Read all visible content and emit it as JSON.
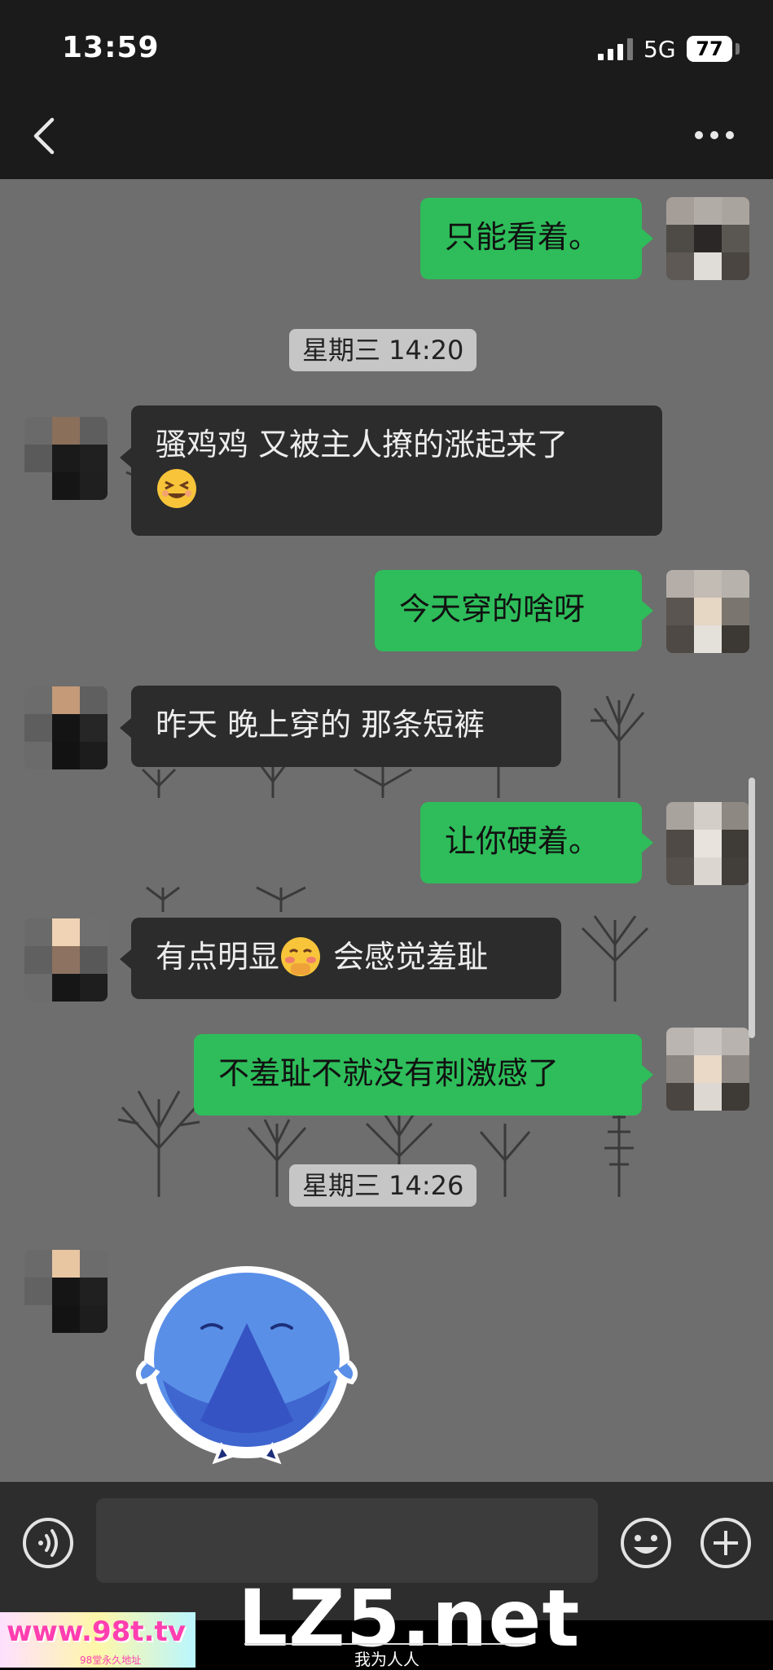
{
  "status_bar": {
    "time": "13:59",
    "network": "5G",
    "battery": "77"
  },
  "nav": {
    "back_icon": "chevron-left-icon",
    "more_icon": "more-dots-icon"
  },
  "messages": [
    {
      "side": "me",
      "text": "只能看着。"
    },
    {
      "type": "timestamp",
      "text": "星期三 14:20"
    },
    {
      "side": "them",
      "text": "骚鸡鸡 又被主人撩的涨起来了",
      "emoji": "grinning-squint-face"
    },
    {
      "side": "me",
      "text": "今天穿的啥呀"
    },
    {
      "side": "them",
      "text": "昨天 晚上穿的 那条短裤"
    },
    {
      "side": "me",
      "text": "让你硬着。"
    },
    {
      "side": "them",
      "text_before": "有点明显",
      "emoji": "shy-face",
      "text_after": "会感觉羞耻"
    },
    {
      "side": "me",
      "text": "不羞耻不就没有刺激感了"
    },
    {
      "type": "timestamp",
      "text": "星期三 14:26"
    },
    {
      "side": "them",
      "type": "sticker",
      "sticker": "blue-round-character-sticker"
    }
  ],
  "input_bar": {
    "voice_icon": "voice-icon",
    "emoji_icon": "smiley-icon",
    "plus_icon": "plus-icon"
  },
  "watermarks": {
    "main": "LZ5.net",
    "sub": "我为人人",
    "left": "www.98t.tv",
    "left_sub": "98堂永久地址"
  },
  "colors": {
    "my_bubble": "#2ebd5a",
    "their_bubble": "#2c2c2c",
    "chat_bg": "#6e6e6e",
    "bar_bg": "#1b1b1b"
  }
}
